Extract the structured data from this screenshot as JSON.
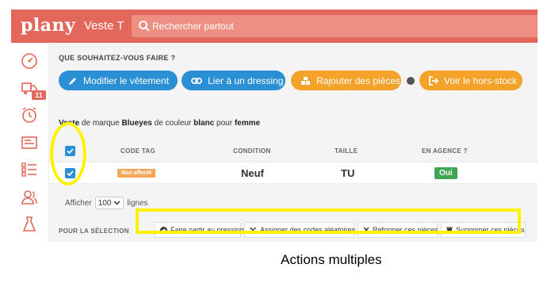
{
  "header": {
    "logo": "plany",
    "title": "Veste T",
    "search_placeholder": "Rechercher partout"
  },
  "sidebar": {
    "items": [
      {
        "icon": "gauge-icon"
      },
      {
        "icon": "delivery-truck-icon",
        "badge": "11"
      },
      {
        "icon": "alarm-clock-icon"
      },
      {
        "icon": "tag-list-icon"
      },
      {
        "icon": "checklist-icon"
      },
      {
        "icon": "users-icon"
      },
      {
        "icon": "dress-icon"
      }
    ]
  },
  "main": {
    "question": "QUE SOUHAITEZ-VOUS FAIRE ?",
    "actions": {
      "modify": "Modifier le vêtement",
      "link": "Lier à un dressing",
      "add_parts": "Rajouter des pièces",
      "out_stock": "Voir le hors-stock"
    },
    "description": {
      "item": "Veste",
      "t1": " de marque ",
      "brand": "Blueyes",
      "t2": " de couleur ",
      "color": "blanc",
      "t3": " pour ",
      "gender": "femme"
    },
    "table": {
      "headers": [
        "CODE TAG",
        "CONDITION",
        "TAILLE",
        "EN AGENCE ?"
      ],
      "rows": [
        {
          "tag": "Non affecté",
          "condition": "Neuf",
          "size": "TU",
          "in_agency": "Oui"
        }
      ]
    },
    "paging": {
      "prefix": "Afficher",
      "value": "100",
      "suffix": "lignes"
    },
    "selection": {
      "label": "POUR LA SÉLECTION",
      "buttons": [
        "Faire partir au pressing",
        "Assigner des codes aléatoires",
        "Reformer ces pièces",
        "Supprimer ces pièces"
      ]
    }
  },
  "caption": "Actions multiples",
  "colors": {
    "brand": "#e3685b",
    "blue": "#2a8fd4",
    "orange": "#f5a22b",
    "green": "#41a556",
    "highlight": "#fff200"
  }
}
